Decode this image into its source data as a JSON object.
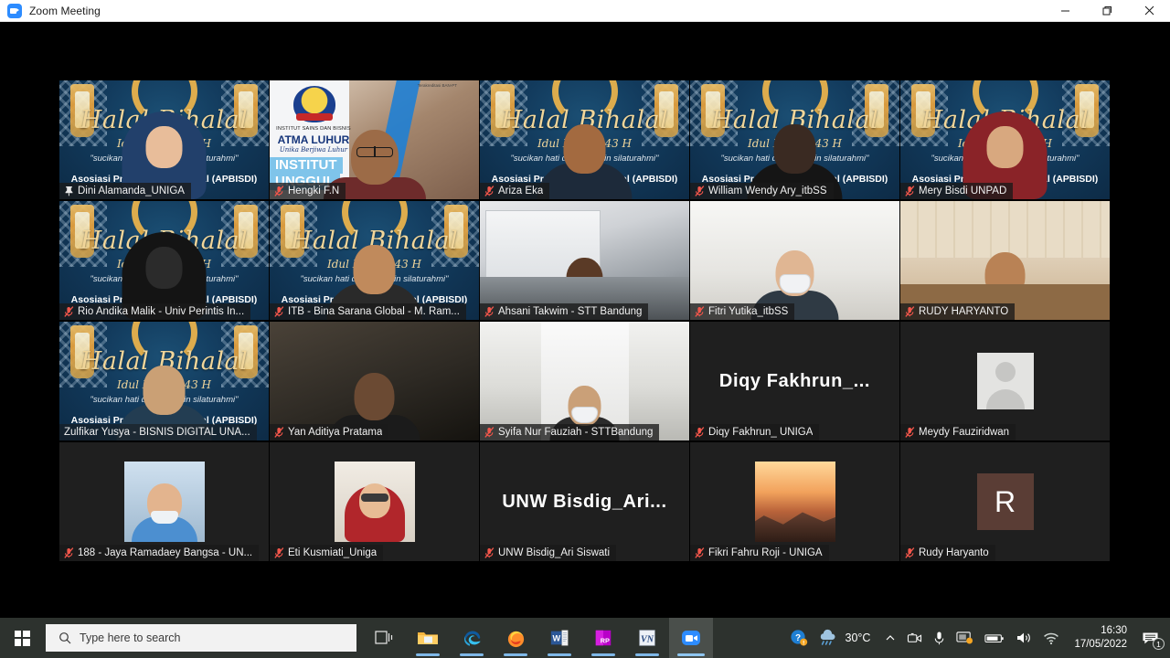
{
  "window": {
    "title": "Zoom Meeting",
    "app_icon": "zoom-video-icon",
    "minimize_label": "Minimize",
    "restore_label": "Restore",
    "close_label": "Close"
  },
  "virtual_background": {
    "halal": {
      "line1": "Halal Bihalal",
      "line2": "Idul Fitri 1443 H",
      "line3": "\"sucikan hati dan menjalin silaturahmi\"",
      "line4": "Asosiasi Profesi Bisnis Digital (APBISDI)"
    },
    "atma": {
      "line1": "INSTITUT SAINS DAN BISNIS",
      "line2": "ATMA LUHUR",
      "line3": "Unika Berjiwa Luhur",
      "line4": "INSTITUT",
      "line5": "UNGGUL",
      "corner": "Terakreditasi BAN-PT"
    }
  },
  "gallery": {
    "participants": [
      {
        "name": "Dini Alamanda_UNIGA",
        "status_icon": "pin-icon",
        "video": true,
        "bg": "halal",
        "active": false
      },
      {
        "name": "Hengki F.N",
        "status_icon": "mic-off-icon",
        "video": true,
        "bg": "atma",
        "active": false
      },
      {
        "name": "Ariza Eka",
        "status_icon": "mic-off-icon",
        "video": true,
        "bg": "halal",
        "active": false
      },
      {
        "name": "William Wendy Ary_itbSS",
        "status_icon": "mic-off-icon",
        "video": true,
        "bg": "halal",
        "active": false
      },
      {
        "name": "Mery Bisdi UNPAD",
        "status_icon": "mic-off-icon",
        "video": true,
        "bg": "halal",
        "active": false
      },
      {
        "name": "Rio Andika Malik - Univ Perintis In...",
        "status_icon": "mic-off-icon",
        "video": true,
        "bg": "halal",
        "active": false
      },
      {
        "name": "ITB - Bina Sarana Global - M. Ram...",
        "status_icon": "mic-off-icon",
        "video": true,
        "bg": "halal",
        "active": false
      },
      {
        "name": "Ahsani Takwim - STT Bandung",
        "status_icon": "mic-off-icon",
        "video": true,
        "bg": "office",
        "active": false
      },
      {
        "name": "Fitri Yutika_itbSS",
        "status_icon": "mic-off-icon",
        "video": true,
        "bg": "white",
        "active": false
      },
      {
        "name": "RUDY HARYANTO",
        "status_icon": "mic-off-icon",
        "video": true,
        "bg": "wood",
        "active": false
      },
      {
        "name": "Zulfikar Yusya - BISNIS DIGITAL  UNA...",
        "status_icon": "none",
        "video": true,
        "bg": "halal",
        "active": true
      },
      {
        "name": "Yan Aditiya Pratama",
        "status_icon": "mic-off-icon",
        "video": true,
        "bg": "dark-room",
        "active": false
      },
      {
        "name": "Syifa Nur Fauziah - STTBandung",
        "status_icon": "mic-off-icon",
        "video": true,
        "bg": "corridor",
        "active": false
      },
      {
        "name": "Diqy Fakhrun_ UNIGA",
        "status_icon": "mic-off-icon",
        "video": false,
        "bg": "nameplate",
        "plate": "Diqy  Fakhrun_...",
        "active": false
      },
      {
        "name": "Meydy Fauziridwan",
        "status_icon": "mic-off-icon",
        "video": false,
        "bg": "avatar-default",
        "active": false
      },
      {
        "name": "188 - Jaya Ramadaey Bangsa - UN...",
        "status_icon": "mic-off-icon",
        "video": false,
        "bg": "photo-boy",
        "active": false
      },
      {
        "name": "Eti Kusmiati_Uniga",
        "status_icon": "mic-off-icon",
        "video": false,
        "bg": "photo-woman",
        "active": false
      },
      {
        "name": "UNW Bisdig_Ari Siswati",
        "status_icon": "mic-off-icon",
        "video": false,
        "bg": "nameplate",
        "plate": "UNW  Bisdig_Ari...",
        "active": false
      },
      {
        "name": "Fikri Fahru Roji - UNIGA",
        "status_icon": "mic-off-icon",
        "video": false,
        "bg": "photo-sunset",
        "active": false
      },
      {
        "name": "Rudy Haryanto",
        "status_icon": "mic-off-icon",
        "video": false,
        "bg": "avatar-initial",
        "initial": "R",
        "initial_color": "#5a3d35",
        "active": false
      }
    ]
  },
  "taskbar": {
    "start_label": "Start",
    "search_placeholder": "Type here to search",
    "search_icon": "search-icon",
    "apps": [
      {
        "name": "task-view",
        "label": "Task View",
        "running": false,
        "active": false
      },
      {
        "name": "file-explorer",
        "label": "File Explorer",
        "running": true,
        "active": false
      },
      {
        "name": "microsoft-edge",
        "label": "Microsoft Edge",
        "running": true,
        "active": false
      },
      {
        "name": "firefox",
        "label": "Mozilla Firefox",
        "running": true,
        "active": false
      },
      {
        "name": "microsoft-word",
        "label": "Word",
        "running": true,
        "active": false
      },
      {
        "name": "axure-rp",
        "label": "RP",
        "running": true,
        "active": false
      },
      {
        "name": "vn-video-editor",
        "label": "VN",
        "running": true,
        "active": false
      },
      {
        "name": "zoom",
        "label": "Zoom",
        "running": true,
        "active": true
      }
    ],
    "tray": {
      "help_icon": "help-circle-icon",
      "weather_icon": "rain-cloud-icon",
      "temperature": "30°C",
      "show_hidden_icon": "chevron-up-icon",
      "camera_icon": "camera-icon",
      "microphone_icon": "microphone-icon",
      "screen-share_icon": "screen-share-icon",
      "battery_icon": "battery-icon",
      "volume_icon": "volume-icon",
      "network_icon": "wifi-icon",
      "time": "16:30",
      "date": "17/05/2022",
      "notification_icon": "notification-icon",
      "notification_count": "1"
    }
  }
}
